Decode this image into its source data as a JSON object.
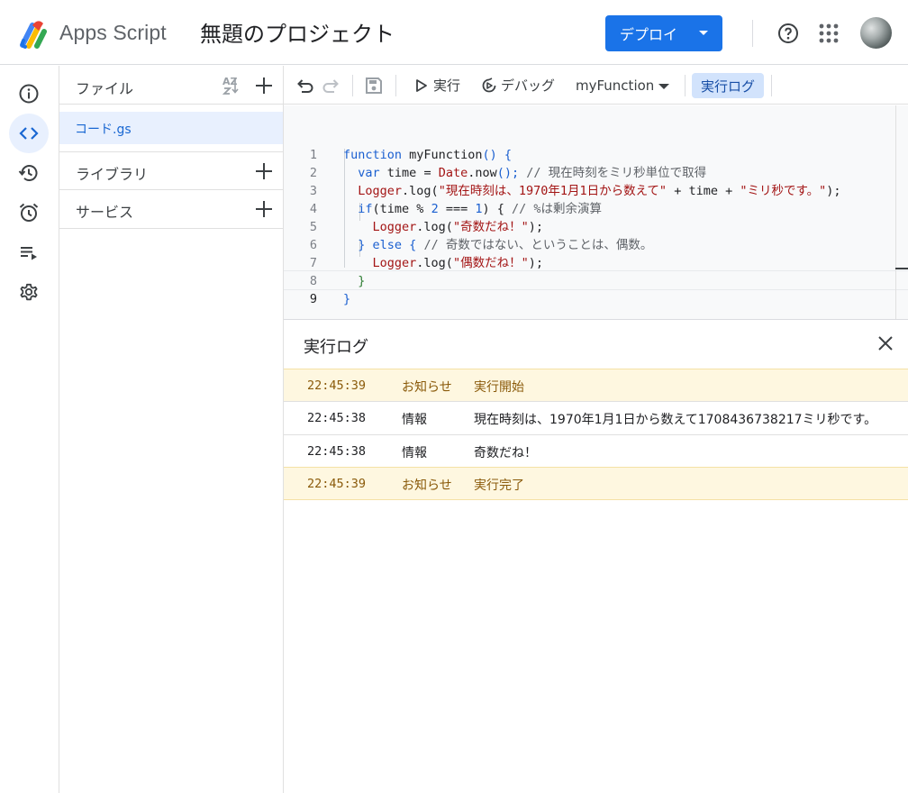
{
  "header": {
    "app_name": "Apps Script",
    "project_title": "無題のプロジェクト",
    "deploy_label": "デプロイ"
  },
  "rail": {
    "items": [
      {
        "icon": "info-icon",
        "active": false
      },
      {
        "icon": "code-icon",
        "active": true
      },
      {
        "icon": "history-icon",
        "active": false
      },
      {
        "icon": "alarm-icon",
        "active": false
      },
      {
        "icon": "executions-icon",
        "active": false
      },
      {
        "icon": "gear-icon",
        "active": false
      }
    ]
  },
  "files": {
    "label": "ファイル",
    "sort_label": "AZ",
    "items": [
      {
        "name": "コード.gs",
        "active": true
      }
    ],
    "libraries_label": "ライブラリ",
    "services_label": "サービス"
  },
  "toolbar": {
    "run_label": "実行",
    "debug_label": "デバッグ",
    "function_name": "myFunction",
    "log_label": "実行ログ"
  },
  "editor": {
    "line_numbers": [
      "1",
      "2",
      "3",
      "4",
      "5",
      "6",
      "7",
      "8",
      "9"
    ],
    "current_line": "9"
  },
  "log": {
    "title": "実行ログ",
    "rows": [
      {
        "time": "22:45:39",
        "level": "お知らせ",
        "message": "実行開始",
        "type": "notice"
      },
      {
        "time": "22:45:38",
        "level": "情報",
        "message": "現在時刻は、1970年1月1日から数えて1708436738217ミリ秒です。",
        "type": "info"
      },
      {
        "time": "22:45:38",
        "level": "情報",
        "message": "奇数だね！",
        "type": "info"
      },
      {
        "time": "22:45:39",
        "level": "お知らせ",
        "message": "実行完了",
        "type": "notice"
      }
    ]
  },
  "colors": {
    "accent": "#1a73e8",
    "notice_bg": "#fef7e0",
    "active_bg": "#e8f0fe"
  }
}
